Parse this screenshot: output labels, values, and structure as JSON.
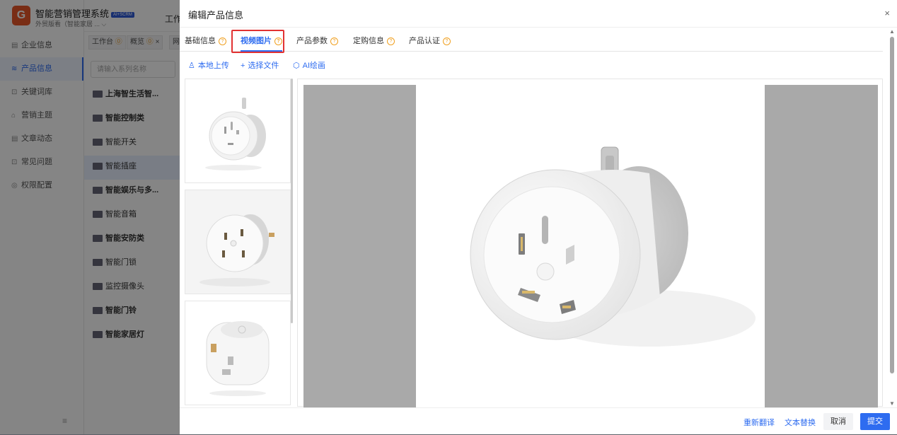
{
  "app": {
    "title": "智能营销管理系统",
    "badge": "AI+SCRM",
    "subtitle": "外贸版看（智能家居 ... ⌵"
  },
  "sidebar": {
    "items": [
      {
        "label": "企业信息",
        "icon": "▤"
      },
      {
        "label": "产品信息",
        "icon": "≋"
      },
      {
        "label": "关键词库",
        "icon": "⊡"
      },
      {
        "label": "营销主题",
        "icon": "⌂"
      },
      {
        "label": "文章动态",
        "icon": "▤"
      },
      {
        "label": "常见问题",
        "icon": "⊡"
      },
      {
        "label": "权限配置",
        "icon": "◎"
      }
    ],
    "collapse": "≡"
  },
  "topbar": {
    "cut_text": "工作"
  },
  "tabs": [
    {
      "label": "工作台",
      "q": "⓪"
    },
    {
      "label": "概览",
      "q": "⓪",
      "close": "×"
    },
    {
      "label": "网"
    }
  ],
  "tree": {
    "search_placeholder": "请输入系列名称",
    "items": [
      {
        "label": "上海智生活智...",
        "bold": true
      },
      {
        "label": "智能控制类",
        "bold": true
      },
      {
        "label": "智能开关",
        "bold": false
      },
      {
        "label": "智能插座",
        "bold": false
      },
      {
        "label": "智能娱乐与多...",
        "bold": true
      },
      {
        "label": "智能音箱",
        "bold": false
      },
      {
        "label": "智能安防类",
        "bold": true
      },
      {
        "label": "智能门锁",
        "bold": false
      },
      {
        "label": "监控摄像头",
        "bold": false
      },
      {
        "label": "智能门铃",
        "bold": true
      },
      {
        "label": "智能家居灯",
        "bold": true
      }
    ]
  },
  "modal": {
    "title": "编辑产品信息",
    "close": "×",
    "tabs": [
      {
        "label": "基础信息"
      },
      {
        "label": "视频图片"
      },
      {
        "label": "产品参数"
      },
      {
        "label": "定购信息"
      },
      {
        "label": "产品认证"
      }
    ],
    "active_tab": "视频图片",
    "tools": [
      {
        "label": "本地上传",
        "icon": "♙"
      },
      {
        "label": "选择文件",
        "icon": "+"
      },
      {
        "label": "AI绘画",
        "icon": "⬡"
      }
    ],
    "footer": {
      "retranslate": "重新翻译",
      "replace_text": "文本替换",
      "cancel": "取消",
      "submit": "提交"
    }
  },
  "colors": {
    "primary": "#2e6cf0",
    "highlight_box": "#e23232",
    "help_icon": "#f0a020",
    "preview_bg": "#a9a9a9"
  }
}
